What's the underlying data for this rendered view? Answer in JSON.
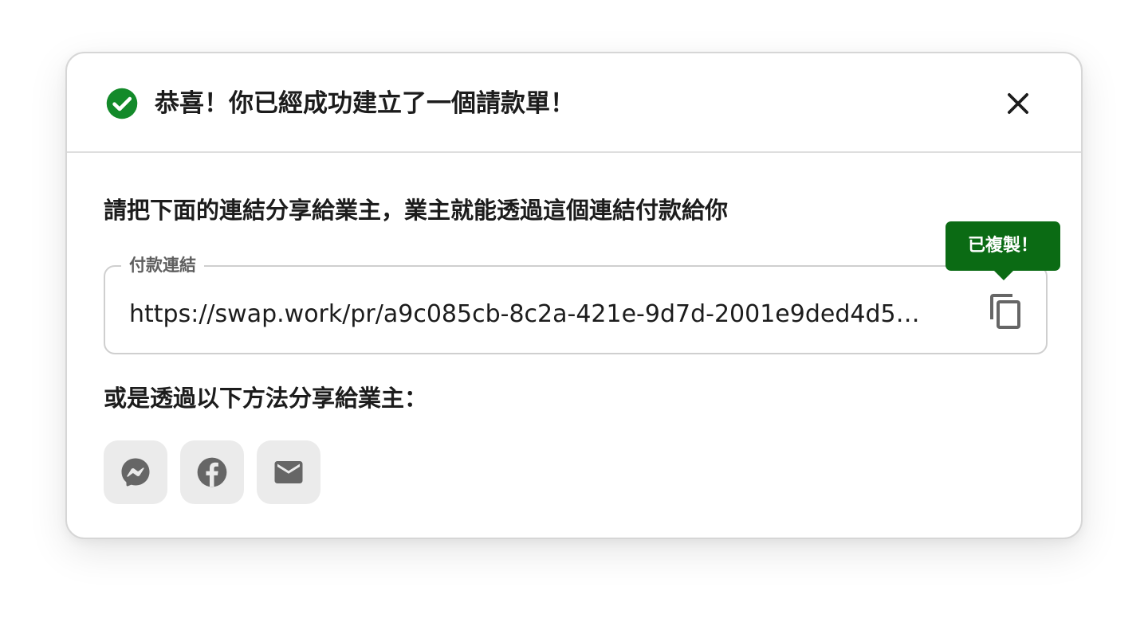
{
  "dialog": {
    "title": "恭喜！你已經成功建立了一個請款單！",
    "instruction": "請把下面的連結分享給業主，業主就能透過這個連結付款給你",
    "link_field": {
      "legend": "付款連結",
      "value": "https://swap.work/pr/a9c085cb-8c2a-421e-9d7d-2001e9ded4d5?..."
    },
    "copy_tooltip": "已複製！",
    "share_label": "或是透過以下方法分享給業主：",
    "share_buttons": [
      {
        "icon": "messenger-icon"
      },
      {
        "icon": "facebook-icon"
      },
      {
        "icon": "email-icon"
      }
    ]
  },
  "colors": {
    "success_green": "#138a2a",
    "tooltip_green": "#0b6b14",
    "icon_gray": "#666666",
    "button_bg": "#ebebeb",
    "text": "#1c1c1c"
  }
}
